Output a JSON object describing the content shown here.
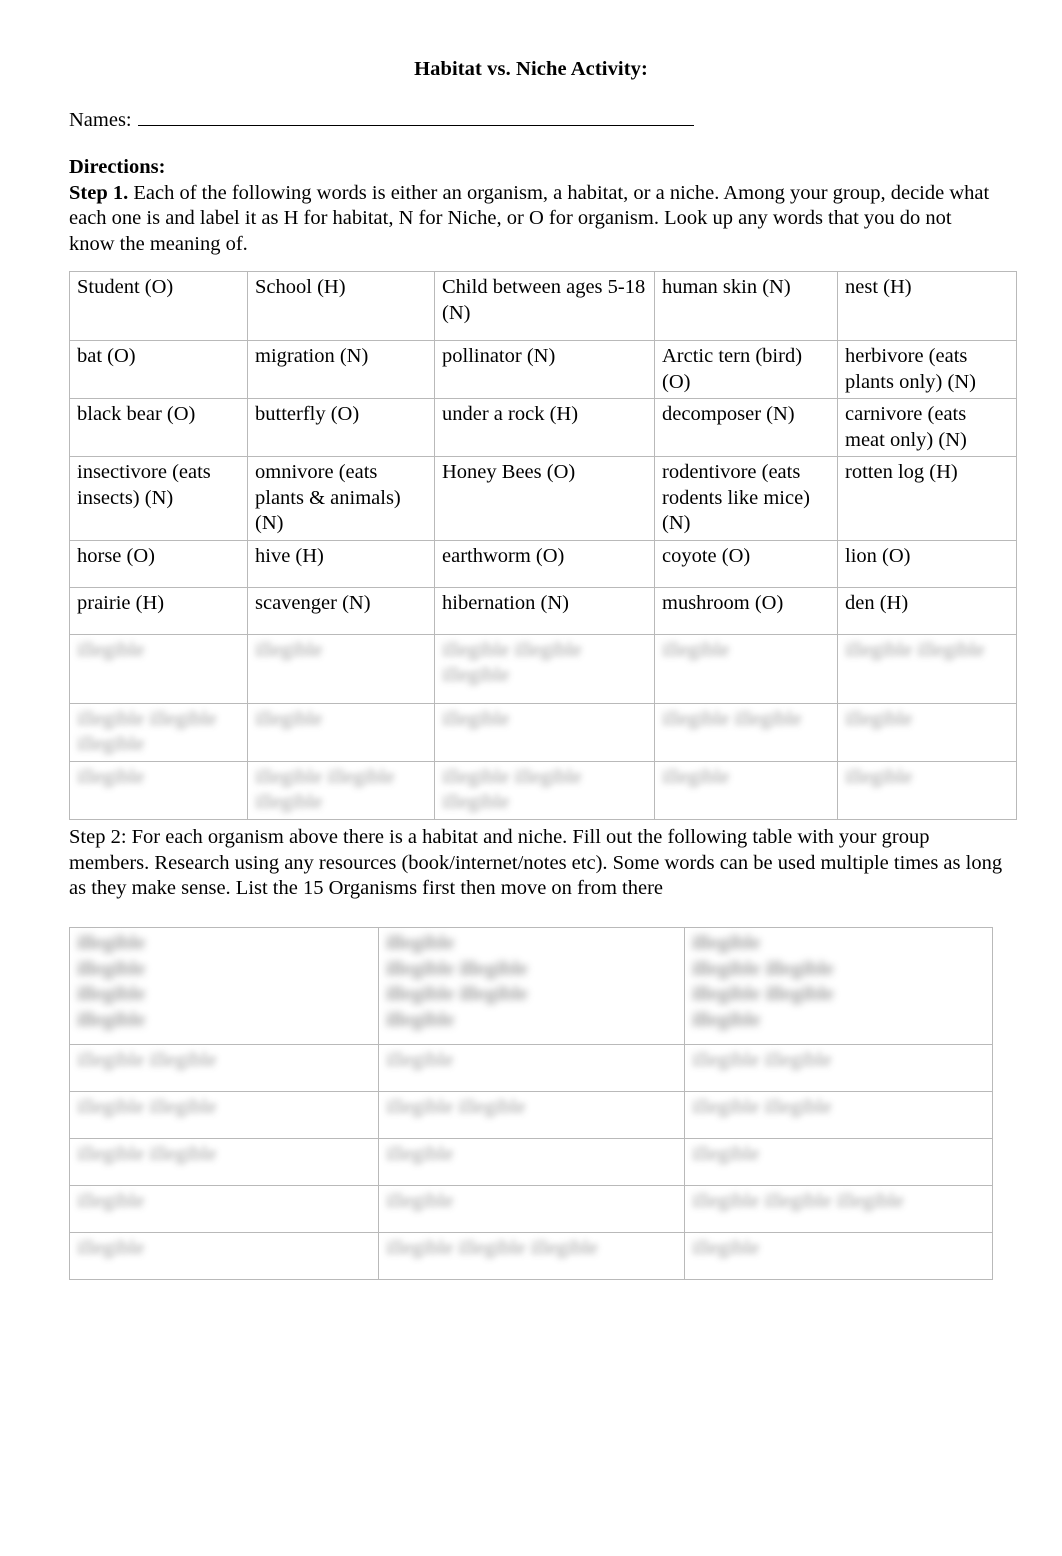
{
  "document": {
    "title": "Habitat vs. Niche Activity:",
    "names_label": "Names:",
    "directions_label": "Directions:",
    "step1_label": "Step 1.",
    "step1_text": " Each of the following words is either an organism, a habitat, or a niche. Among your group, decide what each one is and label it as H for habitat, N for Niche, or O for organism. Look up any words that you do not know the meaning of.",
    "step2_text": "Step 2: For each organism above there is a habitat and niche. Fill out the following table with your group members.  Research using any resources (book/internet/notes etc).  Some words can be used multiple times as long as they make sense.  List the 15 Organisms first then move on from there"
  },
  "word_table": {
    "columns": 5,
    "rows": [
      {
        "redacted": false,
        "cells": [
          "Student (O)",
          "School (H)",
          "Child between ages 5-18\n(N)",
          "human skin (N)",
          "nest (H)"
        ]
      },
      {
        "redacted": false,
        "cells": [
          "bat (O)",
          "migration (N)",
          "pollinator (N)",
          "Arctic tern (bird) (O)",
          "herbivore (eats plants only) (N)"
        ]
      },
      {
        "redacted": false,
        "cells": [
          "black bear (O)",
          "butterfly (O)",
          "under a rock (H)",
          "decomposer (N)",
          "carnivore (eats meat only) (N)"
        ]
      },
      {
        "redacted": false,
        "cells": [
          "insectivore (eats insects) (N)",
          "omnivore (eats plants & animals) (N)",
          "Honey Bees (O)",
          "rodentivore (eats rodents like mice) (N)",
          "rotten log (H)"
        ]
      },
      {
        "redacted": false,
        "cells": [
          "horse (O)",
          "hive (H)",
          "earthworm (O)",
          "coyote (O)",
          "lion (O)"
        ]
      },
      {
        "redacted": false,
        "cells": [
          "prairie (H)",
          "scavenger (N)",
          "hibernation (N)",
          "mushroom (O)",
          "den (H)"
        ]
      },
      {
        "redacted": true,
        "cells": [
          "illegible",
          "illegible",
          "illegible illegible illegible",
          "illegible",
          "illegible illegible"
        ]
      },
      {
        "redacted": true,
        "cells": [
          "illegible illegible illegible",
          "illegible",
          "illegible",
          "illegible illegible",
          "illegible"
        ]
      },
      {
        "redacted": true,
        "cells": [
          "illegible",
          "illegible illegible illegible",
          "illegible illegible illegible",
          "illegible",
          "illegible"
        ]
      }
    ]
  },
  "organism_table": {
    "columns": 3,
    "header": {
      "redacted": true,
      "cells": [
        "illegible\nillegible\nillegible\nillegible",
        "illegible\nillegible illegible\nillegible illegible\nillegible",
        "illegible\nillegible illegible\nillegible illegible\nillegible"
      ]
    },
    "rows": [
      {
        "redacted": true,
        "cells": [
          "illegible illegible",
          "illegible",
          "illegible illegible"
        ]
      },
      {
        "redacted": true,
        "cells": [
          "illegible illegible",
          "illegible illegible",
          "illegible illegible"
        ]
      },
      {
        "redacted": true,
        "cells": [
          "illegible illegible",
          "illegible",
          "illegible"
        ]
      },
      {
        "redacted": true,
        "cells": [
          "illegible",
          "illegible",
          "illegible illegible illegible"
        ]
      },
      {
        "redacted": true,
        "cells": [
          "illegible",
          "illegible illegible illegible",
          "illegible"
        ]
      }
    ]
  }
}
